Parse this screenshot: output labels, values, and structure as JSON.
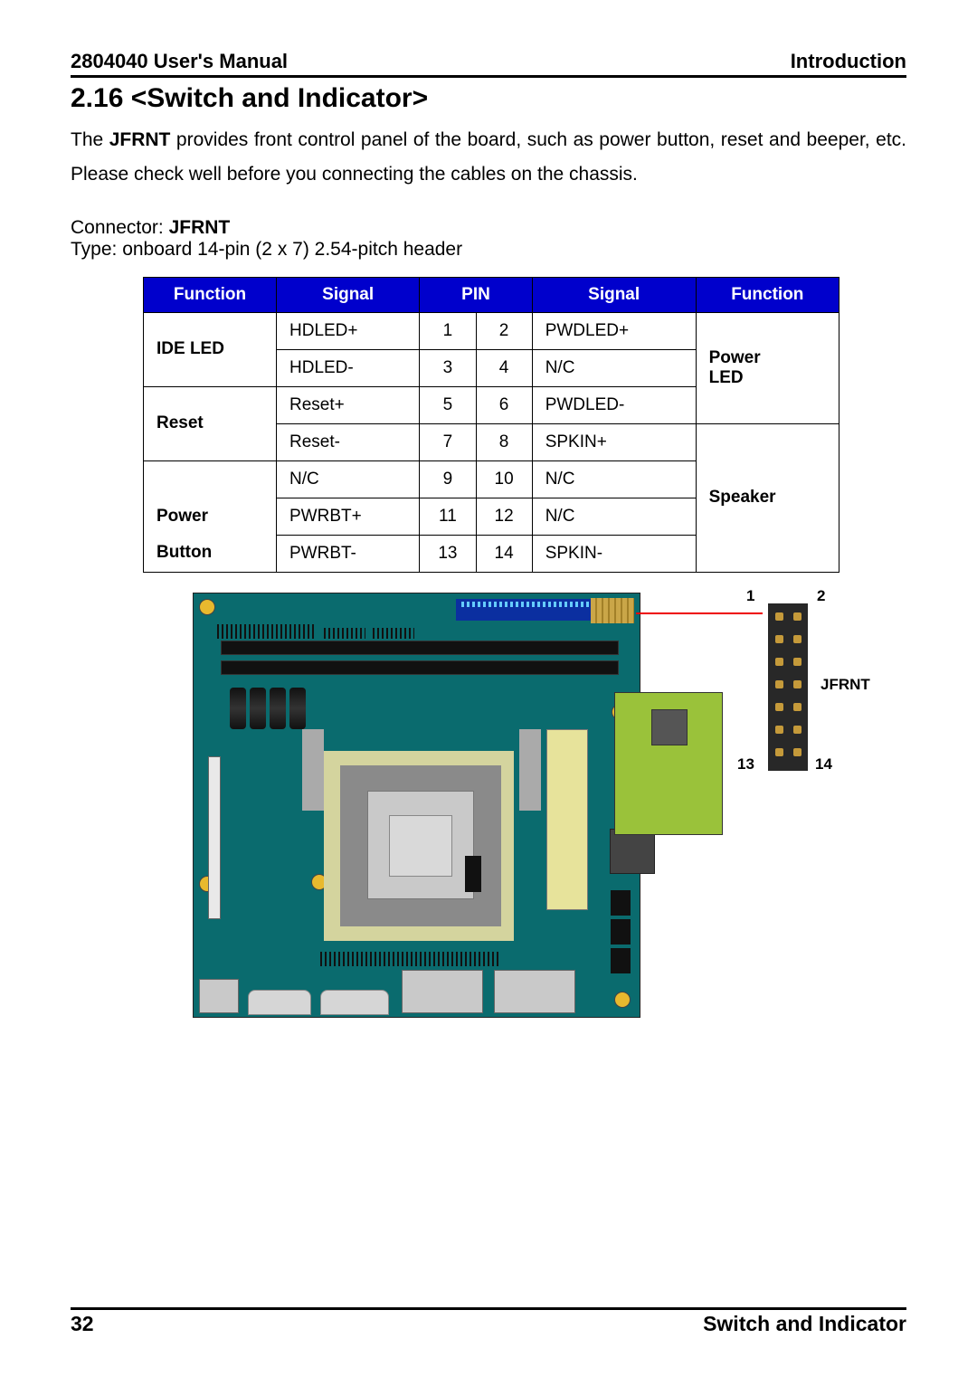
{
  "header": {
    "left": "2804040 User's Manual",
    "right": "Introduction"
  },
  "section_title": "2.16 <Switch and Indicator>",
  "body_pre": "The ",
  "body_bold": "JFRNT",
  "body_post": " provides front control panel of the board, such as power button, reset and beeper, etc. Please check well before you connecting the cables on the chassis.",
  "connector_label": "Connector: ",
  "connector_name": "JFRNT",
  "type_line": "Type: onboard 14-pin (2 x 7) 2.54-pitch header",
  "table": {
    "headers": [
      "Function",
      "Signal",
      "PIN",
      "Signal",
      "Function"
    ],
    "rows": [
      {
        "fn_l": "IDE LED",
        "sig_l": "HDLED+",
        "p1": "1",
        "p2": "2",
        "sig_r": "PWDLED+",
        "fn_r": "Power"
      },
      {
        "fn_l": "",
        "sig_l": "HDLED-",
        "p1": "3",
        "p2": "4",
        "sig_r": "N/C",
        "fn_r": "LED"
      },
      {
        "fn_l": "Reset",
        "sig_l": "Reset+",
        "p1": "5",
        "p2": "6",
        "sig_r": "PWDLED-",
        "fn_r": ""
      },
      {
        "fn_l": "",
        "sig_l": "Reset-",
        "p1": "7",
        "p2": "8",
        "sig_r": "SPKIN+",
        "fn_r": ""
      },
      {
        "fn_l": "",
        "sig_l": "N/C",
        "p1": "9",
        "p2": "10",
        "sig_r": "N/C",
        "fn_r": "Speaker"
      },
      {
        "fn_l": "Power",
        "sig_l": "PWRBT+",
        "p1": "11",
        "p2": "12",
        "sig_r": "N/C",
        "fn_r": ""
      },
      {
        "fn_l": "Button",
        "sig_l": "PWRBT-",
        "p1": "13",
        "p2": "14",
        "sig_r": "SPKIN-",
        "fn_r": ""
      }
    ]
  },
  "diagram": {
    "pin_top_left": "1",
    "pin_top_right": "2",
    "conn_label": "JFRNT",
    "pin_bot_left": "13",
    "pin_bot_right": "14"
  },
  "footer": {
    "page": "32",
    "title": "Switch and Indicator"
  }
}
